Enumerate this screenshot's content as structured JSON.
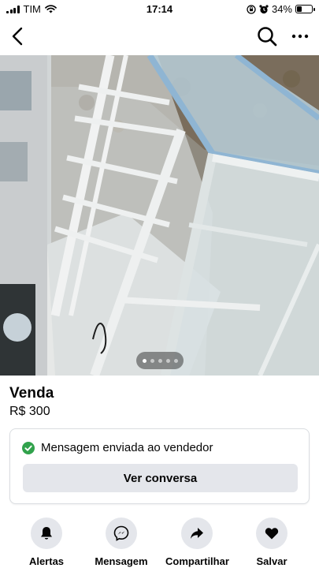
{
  "status_bar": {
    "carrier": "TIM",
    "time": "17:14",
    "battery_percent": "34%",
    "battery_level": 0.34,
    "icons": [
      "signal-icon",
      "wifi-icon",
      "orientation-lock-icon",
      "alarm-icon",
      "battery-icon"
    ]
  },
  "nav": {
    "icons": [
      "back-chevron-icon",
      "search-icon",
      "more-icon"
    ]
  },
  "gallery": {
    "photo_subject": "glass display cabinet",
    "page_count": 5,
    "active_index": 0
  },
  "listing": {
    "title": "Venda",
    "price": "R$ 300"
  },
  "message_card": {
    "status_text": "Mensagem enviada ao vendedor",
    "button_label": "Ver conversa",
    "status_color": "#31a24c"
  },
  "actions": [
    {
      "label": "Alertas",
      "icon": "bell-icon"
    },
    {
      "label": "Mensagem",
      "icon": "messenger-icon"
    },
    {
      "label": "Compartilhar",
      "icon": "share-icon"
    },
    {
      "label": "Salvar",
      "icon": "heart-icon"
    }
  ],
  "colors": {
    "button_bg": "#e4e6eb",
    "text": "#050505",
    "card_border": "#dadde1"
  }
}
